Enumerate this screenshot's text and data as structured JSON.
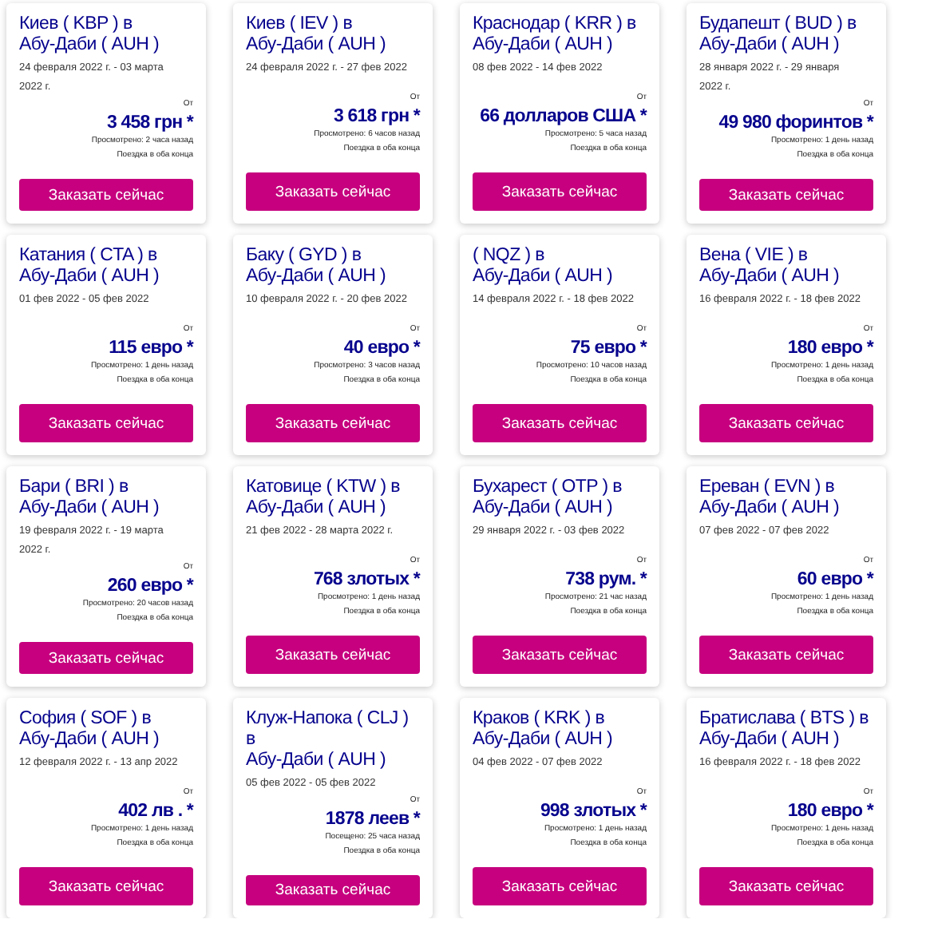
{
  "cards": [
    {
      "from": "Киев ( KBP ) в",
      "to": "Абу-Даби ( AUH )",
      "dates": "24 февраля 2022 г. - 03 марта 2022 г.",
      "from_label": "От",
      "price": "3 458 грн *",
      "viewed": "Просмотрено: 2 часа назад",
      "trip": "Поездка в оба конца",
      "button": "Заказать сейчас"
    },
    {
      "from": "Киев ( IEV ) в",
      "to": "Абу-Даби ( AUH )",
      "dates": "24 февраля 2022 г. - 27 фев 2022",
      "from_label": "От",
      "price": "3 618 грн *",
      "viewed": "Просмотрено: 6 часов назад",
      "trip": "Поездка в оба конца",
      "button": "Заказать сейчас"
    },
    {
      "from": "Краснодар ( KRR ) в",
      "to": "Абу-Даби ( AUH )",
      "dates": "08 фев 2022 - 14 фев 2022",
      "from_label": "От",
      "price": "66 долларов США *",
      "viewed": "Просмотрено: 5 часа назад",
      "trip": "Поездка в оба конца",
      "button": "Заказать сейчас"
    },
    {
      "from": "Будапешт ( BUD ) в",
      "to": "Абу-Даби ( AUH )",
      "dates": "28 января 2022 г. - 29 января 2022 г.",
      "from_label": "От",
      "price": "49 980 форинтов *",
      "viewed": "Просмотрено: 1 день назад",
      "trip": "Поездка в оба конца",
      "button": "Заказать сейчас"
    },
    {
      "from": "Катания ( CTA ) в",
      "to": "Абу-Даби ( AUH )",
      "dates": "01 фев 2022 - 05 фев 2022",
      "from_label": "От",
      "price": "115 евро *",
      "viewed": "Просмотрено: 1 день назад",
      "trip": "Поездка в оба конца",
      "button": "Заказать сейчас"
    },
    {
      "from": "Баку ( GYD ) в",
      "to": "Абу-Даби ( AUH )",
      "dates": "10 февраля 2022 г. - 20 фев 2022",
      "from_label": "От",
      "price": "40 евро *",
      "viewed": "Просмотрено: 3 часов назад",
      "trip": "Поездка в оба конца",
      "button": "Заказать сейчас"
    },
    {
      "from": "( NQZ ) в",
      "to": "Абу-Даби ( AUH )",
      "dates": "14 февраля 2022 г. - 18 фев 2022",
      "from_label": "От",
      "price": "75 евро *",
      "viewed": "Просмотрено: 10 часов назад",
      "trip": "Поездка в оба конца",
      "button": "Заказать сейчас"
    },
    {
      "from": "Вена ( VIE ) в",
      "to": "Абу-Даби ( AUH )",
      "dates": "16 февраля 2022 г. - 18 фев 2022",
      "from_label": "От",
      "price": "180 евро *",
      "viewed": "Просмотрено: 1 день назад",
      "trip": "Поездка в оба конца",
      "button": "Заказать сейчас"
    },
    {
      "from": "Бари ( BRI ) в",
      "to": "Абу-Даби ( AUH )",
      "dates": "19 февраля 2022 г. - 19 марта 2022 г.",
      "from_label": "От",
      "price": "260 евро *",
      "viewed": "Просмотрено: 20 часов назад",
      "trip": "Поездка в оба конца",
      "button": "Заказать сейчас"
    },
    {
      "from": "Катовице ( KTW ) в",
      "to": "Абу-Даби ( AUH )",
      "dates": "21 фев 2022 - 28 марта 2022 г.",
      "from_label": "От",
      "price": "768 злотых *",
      "viewed": "Просмотрено: 1 день назад",
      "trip": "Поездка в оба конца",
      "button": "Заказать сейчас"
    },
    {
      "from": "Бухарест ( OTP ) в",
      "to": "Абу-Даби ( AUH )",
      "dates": "29 января 2022 г. - 03 фев 2022",
      "from_label": "От",
      "price": "738 рум. *",
      "viewed": "Просмотрено: 21 час назад",
      "trip": "Поездка в оба конца",
      "button": "Заказать сейчас"
    },
    {
      "from": "Ереван ( EVN ) в",
      "to": "Абу-Даби ( AUH )",
      "dates": "07 фев 2022 - 07 фев 2022",
      "from_label": "От",
      "price": "60 евро *",
      "viewed": "Просмотрено: 1 день назад",
      "trip": "Поездка в оба конца",
      "button": "Заказать сейчас"
    },
    {
      "from": "София ( SOF ) в",
      "to": "Абу-Даби ( AUH )",
      "dates": "12 февраля 2022 г. - 13 апр 2022",
      "from_label": "От",
      "price": "402 лв . *",
      "viewed": "Просмотрено: 1 день назад",
      "trip": "Поездка в оба конца",
      "button": "Заказать сейчас"
    },
    {
      "from": "Клуж-Напока ( CLJ ) в",
      "to": "Абу-Даби ( AUH )",
      "dates": "05 фев 2022 - 05 фев 2022",
      "from_label": "От",
      "price": "1878 леев *",
      "viewed": "Посещено: 25 часа назад",
      "trip": "Поездка в оба конца",
      "button": "Заказать сейчас"
    },
    {
      "from": "Краков ( KRK ) в",
      "to": "Абу-Даби ( AUH )",
      "dates": "04 фев 2022 - 07 фев 2022",
      "from_label": "От",
      "price": "998 злотых *",
      "viewed": "Просмотрено: 1 день назад",
      "trip": "Поездка в оба конца",
      "button": "Заказать сейчас"
    },
    {
      "from": "Братислава ( BTS ) в",
      "to": "Абу-Даби ( AUH )",
      "dates": "16 февраля 2022 г. - 18 фев 2022",
      "from_label": "От",
      "price": "180 евро *",
      "viewed": "Просмотрено: 1 день назад",
      "trip": "Поездка в оба конца",
      "button": "Заказать сейчас"
    }
  ]
}
